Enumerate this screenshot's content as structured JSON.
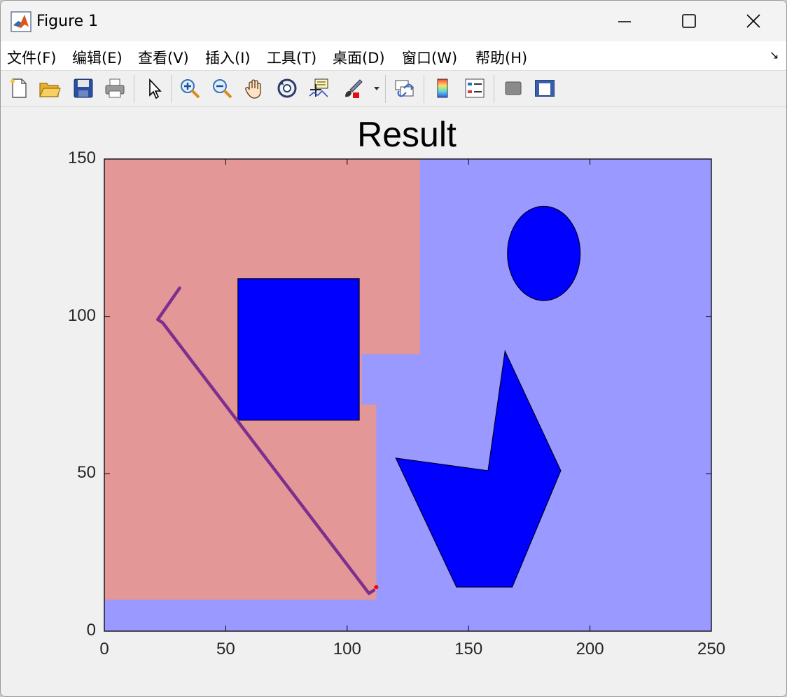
{
  "window": {
    "title": "Figure 1",
    "controls": [
      "minimize",
      "maximize",
      "close"
    ]
  },
  "menu": {
    "items": [
      {
        "label": "文件(F)"
      },
      {
        "label": "编辑(E)"
      },
      {
        "label": "查看(V)"
      },
      {
        "label": "插入(I)"
      },
      {
        "label": "工具(T)"
      },
      {
        "label": "桌面(D)"
      },
      {
        "label": "窗口(W)"
      },
      {
        "label": "帮助(H)"
      }
    ],
    "overflow_icon": "dock-arrow-icon"
  },
  "toolbar": {
    "icons": [
      "new-figure-icon",
      "open-file-icon",
      "save-icon",
      "print-icon",
      "select-arrow-icon",
      "zoom-in-icon",
      "zoom-out-icon",
      "pan-hand-icon",
      "rotate-3d-icon",
      "data-cursor-icon",
      "brush-icon",
      "brush-dropdown-icon",
      "link-plot-icon",
      "colorbar-icon",
      "legend-icon",
      "hide-plot-tools-icon",
      "show-plot-tools-icon"
    ]
  },
  "chart_data": {
    "type": "area",
    "title": "Result",
    "xlabel": "",
    "ylabel": "",
    "xlim": [
      0,
      250
    ],
    "ylim": [
      0,
      150
    ],
    "xticks": [
      0,
      50,
      100,
      150,
      200,
      250
    ],
    "yticks": [
      0,
      50,
      100,
      150
    ],
    "background_color": "#9999ff",
    "regions": [
      {
        "color": "#e39797",
        "polygon": [
          [
            0,
            10
          ],
          [
            112,
            10
          ],
          [
            112,
            72
          ],
          [
            106,
            72
          ],
          [
            106,
            88
          ],
          [
            130,
            88
          ],
          [
            130,
            150
          ],
          [
            0,
            150
          ]
        ]
      }
    ],
    "obstacles": [
      {
        "shape": "rectangle",
        "color": "#0000ff",
        "x": [
          55,
          105
        ],
        "y": [
          67,
          112
        ]
      },
      {
        "shape": "ellipse",
        "color": "#0000ff",
        "center": [
          181,
          120
        ],
        "radius": [
          15,
          15
        ]
      },
      {
        "shape": "polygon",
        "color": "#0000ff",
        "points": [
          [
            120,
            55
          ],
          [
            158,
            51
          ],
          [
            165,
            89
          ],
          [
            188,
            51
          ],
          [
            168,
            14
          ],
          [
            145,
            14
          ]
        ]
      }
    ],
    "path": {
      "color": "#7e2f8e",
      "points": [
        [
          31,
          109
        ],
        [
          22,
          99
        ],
        [
          24,
          98
        ],
        [
          109,
          12
        ],
        [
          111,
          13
        ]
      ]
    },
    "markers": [
      {
        "color": "#ff0000",
        "point": [
          112,
          14
        ]
      }
    ]
  }
}
